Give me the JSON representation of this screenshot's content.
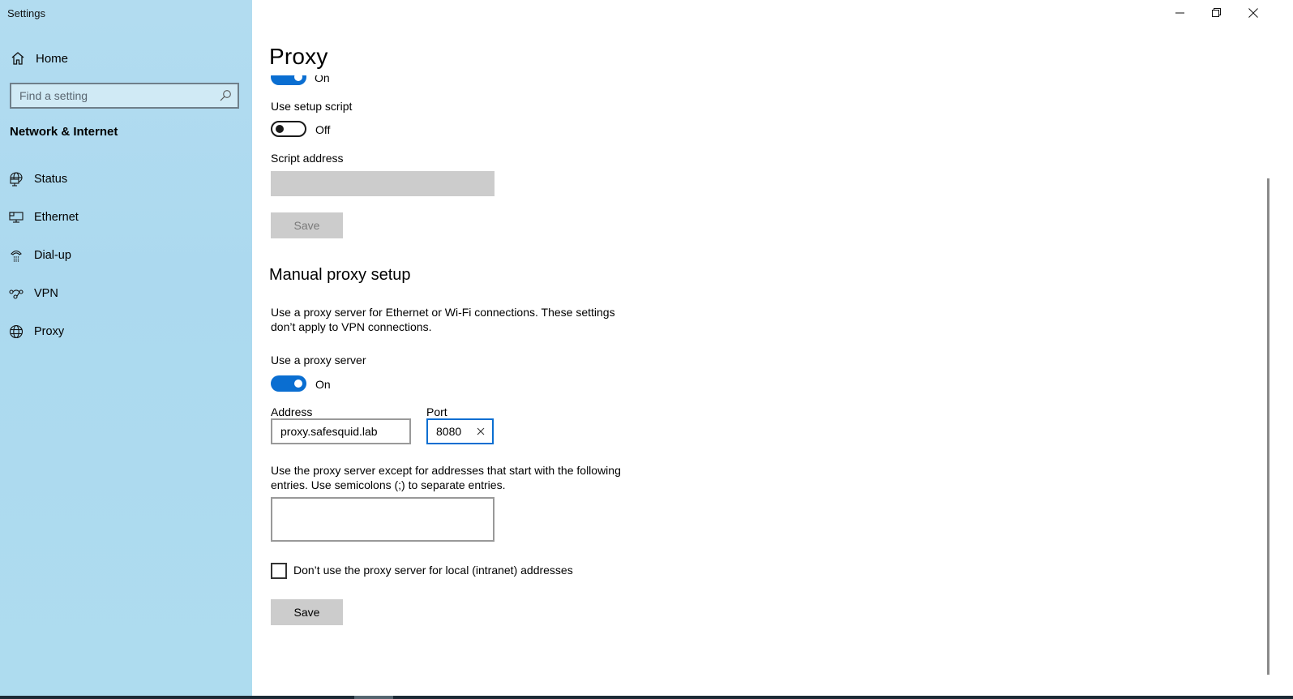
{
  "window": {
    "title": "Settings",
    "controls": {
      "minimize": "minimize-icon",
      "restore": "restore-icon",
      "close": "close-icon"
    }
  },
  "sidebar": {
    "home_label": "Home",
    "search_placeholder": "Find a setting",
    "section_title": "Network & Internet",
    "items": [
      {
        "label": "Status",
        "icon": "globe-monitor-icon"
      },
      {
        "label": "Ethernet",
        "icon": "ethernet-icon"
      },
      {
        "label": "Dial-up",
        "icon": "dialup-phone-icon"
      },
      {
        "label": "VPN",
        "icon": "vpn-icon"
      },
      {
        "label": "Proxy",
        "icon": "globe-icon"
      }
    ],
    "selected": "Proxy"
  },
  "main": {
    "page_title": "Proxy",
    "auto_detect": {
      "state_label": "On",
      "enabled": true
    },
    "setup_script": {
      "label": "Use setup script",
      "state_label": "Off",
      "enabled": false,
      "script_address_label": "Script address",
      "script_address_value": "",
      "save_label": "Save"
    },
    "manual": {
      "title": "Manual proxy setup",
      "description": "Use a proxy server for Ethernet or Wi-Fi connections. These settings don’t apply to VPN connections.",
      "use_proxy_label": "Use a proxy server",
      "use_proxy_state_label": "On",
      "use_proxy_enabled": true,
      "address_label": "Address",
      "address_value": "proxy.safesquid.lab",
      "port_label": "Port",
      "port_value": "8080",
      "exceptions_description": "Use the proxy server except for addresses that start with the following entries. Use semicolons (;) to separate entries.",
      "exceptions_value": "",
      "local_bypass_label": "Don’t use the proxy server for local (intranet) addresses",
      "local_bypass_checked": false,
      "save_label": "Save"
    }
  },
  "colors": {
    "accent": "#0a6ed1",
    "sidebar_bg": "#aedcef",
    "disabled_bg": "#cccccc"
  }
}
